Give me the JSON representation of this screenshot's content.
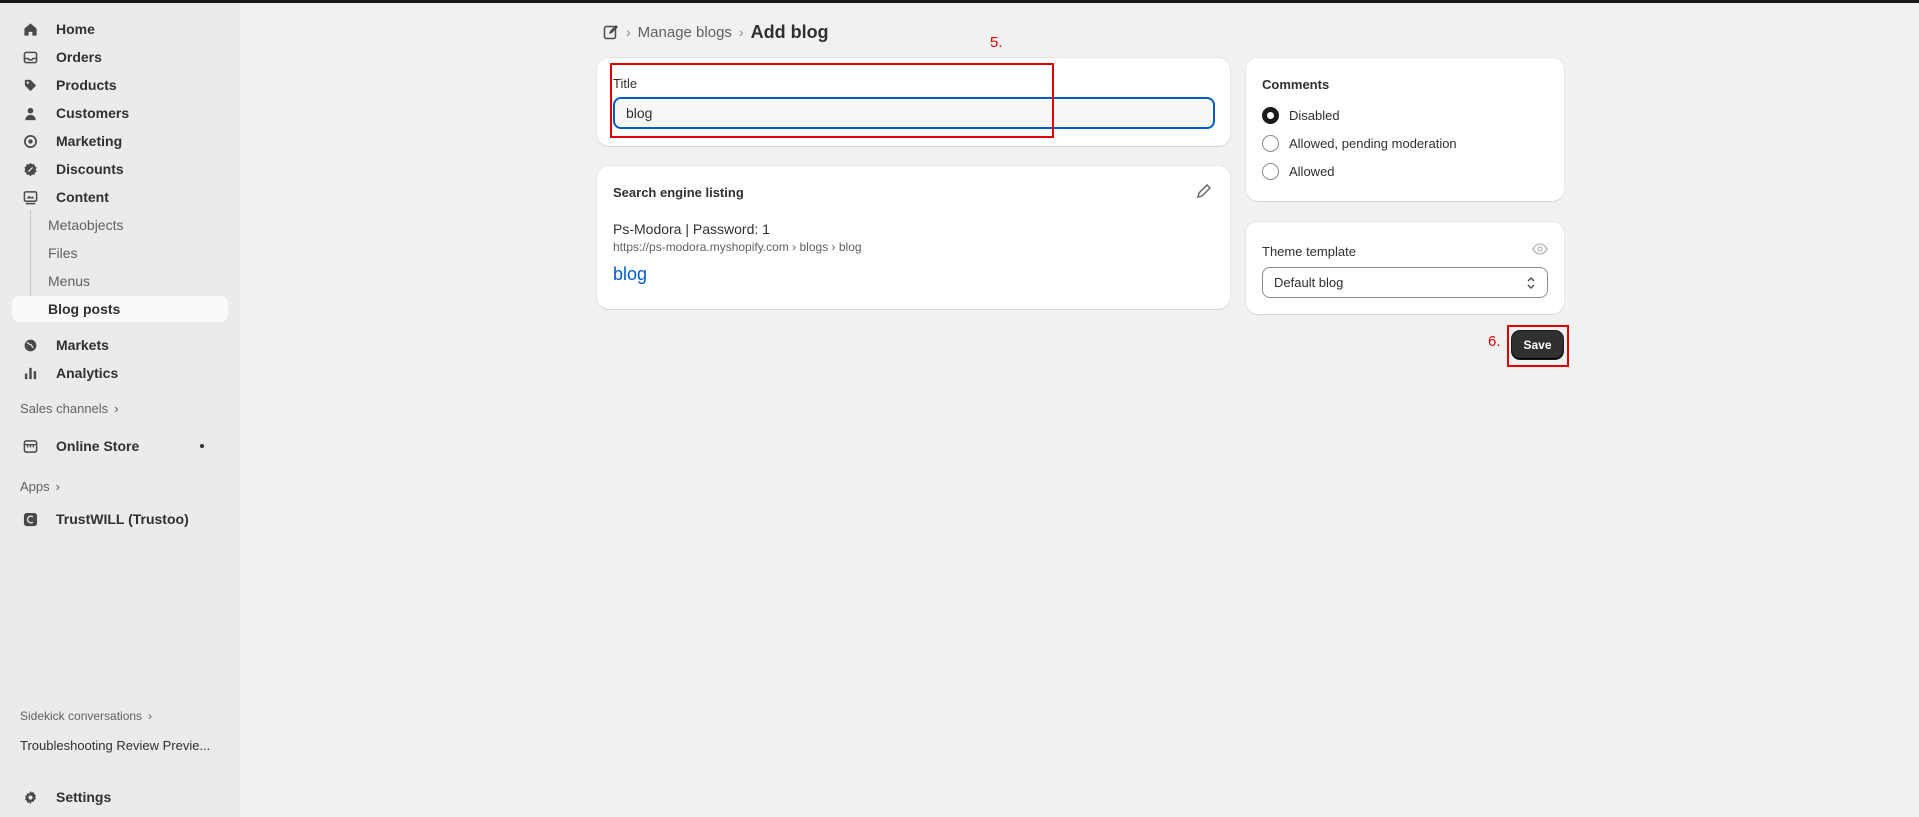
{
  "nav": {
    "home": "Home",
    "orders": "Orders",
    "products": "Products",
    "customers": "Customers",
    "marketing": "Marketing",
    "discounts": "Discounts",
    "content": "Content",
    "metaobjects": "Metaobjects",
    "files": "Files",
    "menus": "Menus",
    "blog_posts": "Blog posts",
    "markets": "Markets",
    "analytics": "Analytics",
    "sales_channels": "Sales channels",
    "online_store": "Online Store",
    "apps": "Apps",
    "trustwill": "TrustWILL (Trustoo)",
    "sidekick": "Sidekick conversations",
    "troubleshooting": "Troubleshooting Review Previe...",
    "settings": "Settings"
  },
  "breadcrumb": {
    "parent": "Manage blogs",
    "current": "Add blog"
  },
  "title_card": {
    "label": "Title",
    "value": "blog"
  },
  "seo": {
    "heading": "Search engine listing",
    "site_title": "Ps-Modora | Password: 1",
    "url": "https://ps-modora.myshopify.com › blogs › blog",
    "page_title": "blog"
  },
  "comments": {
    "heading": "Comments",
    "options": [
      "Disabled",
      "Allowed, pending moderation",
      "Allowed"
    ],
    "selected": "Disabled"
  },
  "theme": {
    "heading": "Theme template",
    "selected": "Default blog"
  },
  "save_label": "Save",
  "annotations": {
    "step5": "5.",
    "step6": "6."
  },
  "colors": {
    "annotation": "#e00000",
    "focus": "#005bd3",
    "link": "#005bd3"
  }
}
